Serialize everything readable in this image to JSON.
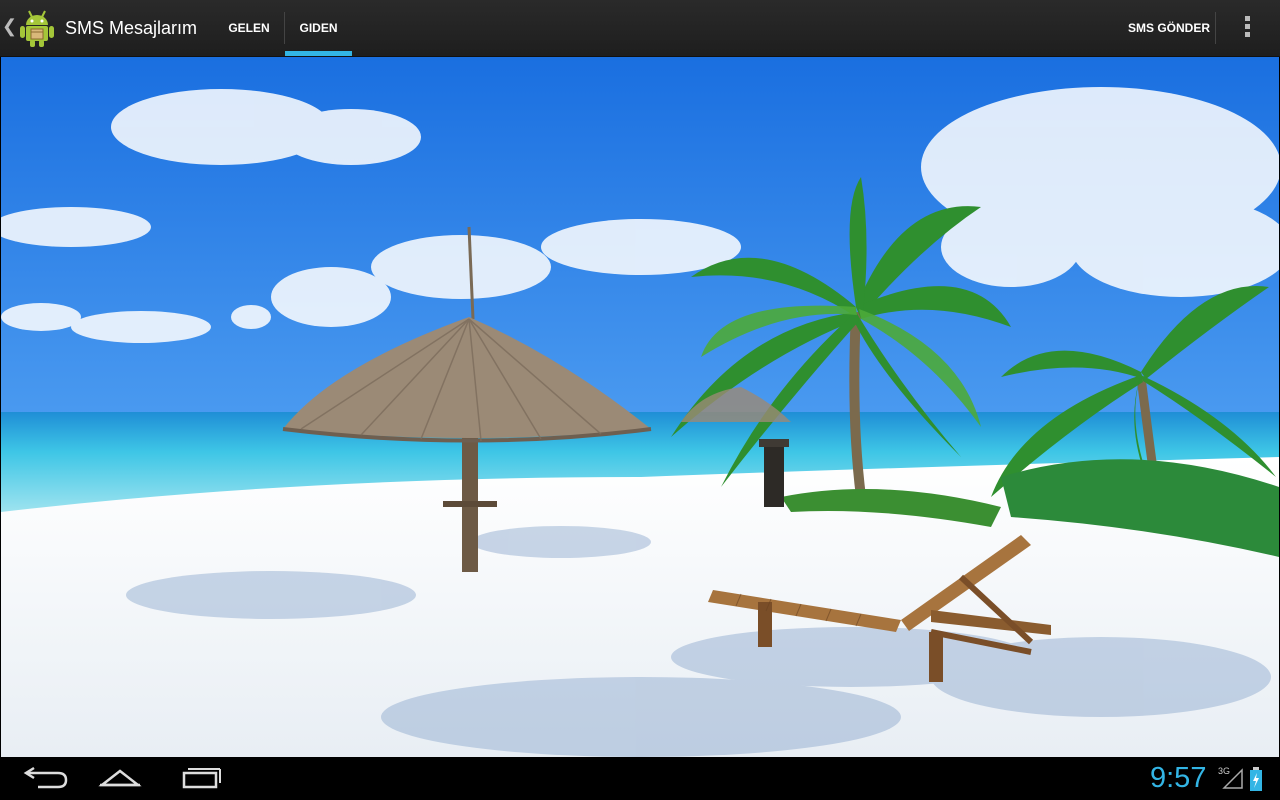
{
  "action_bar": {
    "app_title": "SMS Mesajlarım",
    "tabs": [
      {
        "label": "GELEN",
        "selected": false
      },
      {
        "label": "GIDEN",
        "selected": true
      }
    ],
    "send_button_label": "SMS GÖNDER",
    "icons": {
      "up": "chevron-left-icon",
      "app": "android-icon",
      "overflow": "overflow-menu-icon"
    }
  },
  "status_bar": {
    "time": "9:57",
    "network_type": "3G",
    "icons": [
      "signal-icon",
      "battery-charging-icon"
    ]
  },
  "navigation_bar": {
    "buttons": [
      "back-icon",
      "home-icon",
      "recent-apps-icon"
    ]
  },
  "colors": {
    "accent": "#33b5e5",
    "action_bar": "#222222",
    "sky": "#2e7de0",
    "sea": "#3ec6e6",
    "sand": "#f4f7fa"
  }
}
